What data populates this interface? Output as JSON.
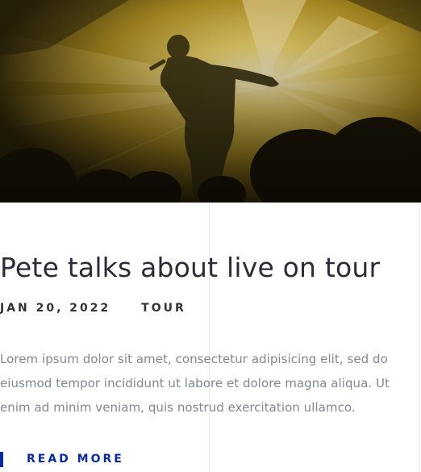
{
  "post": {
    "image_alt": "Singer performing on stage under yellow spotlights",
    "title": "Pete talks about live on tour",
    "date": "JAN 20, 2022",
    "category": "TOUR",
    "excerpt": "Lorem ipsum dolor sit amet, consectetur adipisicing elit, sed do eiusmod tempor incididunt ut labore et dolore magna aliqua. Ut enim ad minim veniam, quis nostrud exercitation ullamco.",
    "read_more_label": "READ MORE"
  },
  "colors": {
    "accent": "#0b2a9c",
    "title": "#2a2d39",
    "body_text": "#838793",
    "photo_tint": "#c9a21f"
  }
}
